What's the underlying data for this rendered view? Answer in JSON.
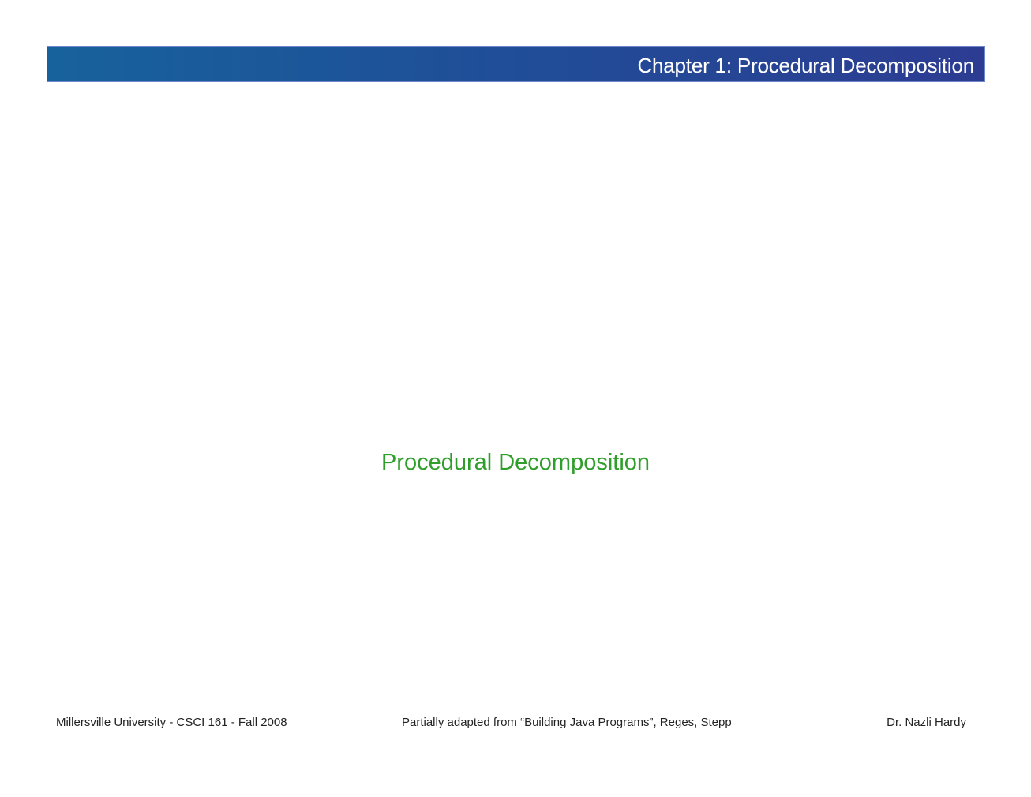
{
  "header": {
    "title": "Chapter 1:  Procedural Decomposition",
    "gradient_start": "#17629d",
    "gradient_end": "#2c3c92"
  },
  "main": {
    "title": "Procedural Decomposition",
    "title_color": "#2f9e2a"
  },
  "footer": {
    "left": "Millersville University - CSCI 161 - Fall 2008",
    "center": "Partially adapted from “Building Java Programs”, Reges, Stepp",
    "right": "Dr. Nazli Hardy"
  }
}
